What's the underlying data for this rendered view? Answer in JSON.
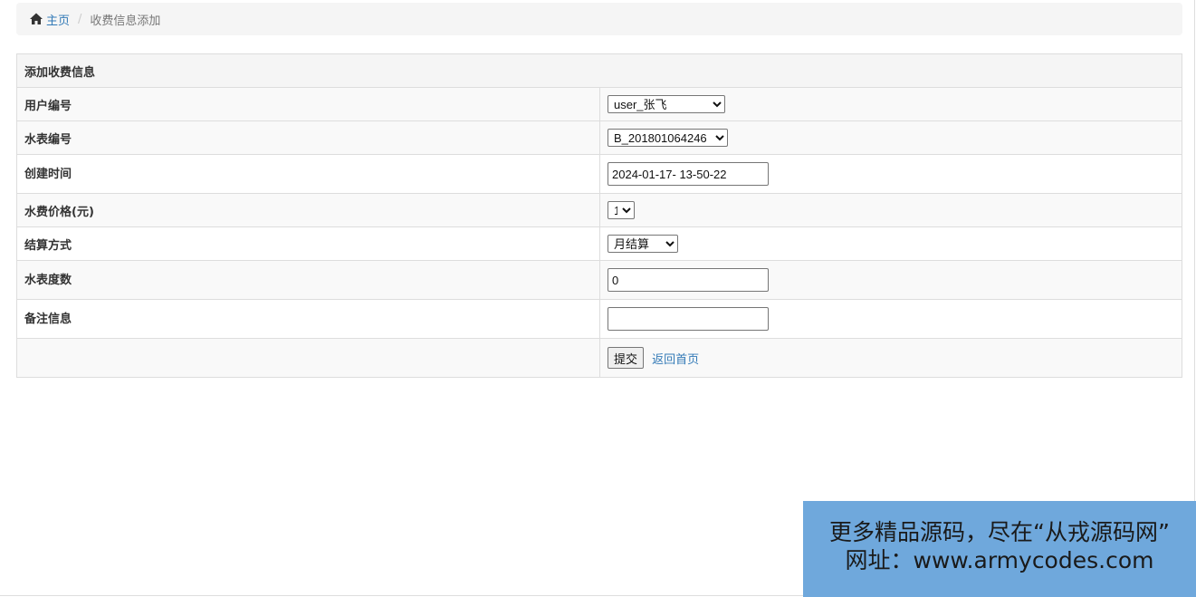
{
  "breadcrumb": {
    "home_label": "主页",
    "separator": "/",
    "current": "收费信息添加"
  },
  "form": {
    "title": "添加收费信息",
    "fields": {
      "user_id": {
        "label": "用户编号",
        "value": "user_张飞"
      },
      "meter_id": {
        "label": "水表编号",
        "value": "B_201801064246"
      },
      "created_time": {
        "label": "创建时间",
        "value": "2024-01-17- 13-50-22"
      },
      "price": {
        "label": "水费价格(元)",
        "value": "1"
      },
      "settlement": {
        "label": "结算方式",
        "value": "月结算"
      },
      "meter_reading": {
        "label": "水表度数",
        "value": "0"
      },
      "remark": {
        "label": "备注信息",
        "value": ""
      }
    },
    "submit_label": "提交",
    "back_label": "返回首页"
  },
  "promo": {
    "line1": "更多精品源码，尽在“从戎源码网”",
    "line2": "网址：www.armycodes.com"
  },
  "colors": {
    "link": "#337ab7",
    "promo_bg": "#6fa8dc",
    "breadcrumb_bg": "#f5f5f5"
  }
}
